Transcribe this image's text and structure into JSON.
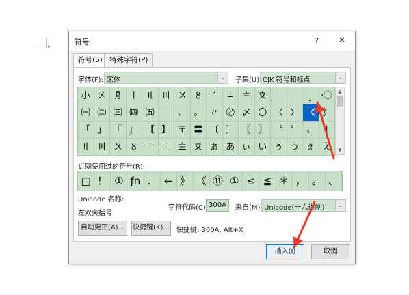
{
  "dialog": {
    "title": "符号",
    "help": "?",
    "close": "✕",
    "tabs": [
      {
        "label": "符号(S)"
      },
      {
        "label": "特殊字符(P)"
      }
    ],
    "font_label": "字体(F):",
    "font_value": "宋体",
    "subset_label": "子集(U):",
    "subset_value": "CJK 符号和标点",
    "grid_rows": [
      [
        "小",
        "㐅",
        "㐆",
        "〡",
        "〢",
        "〣",
        "〤",
        "〥",
        "〦",
        "〧",
        "〨",
        "〩",
        "〪",
        "〫",
        "〭",
        "〮"
      ],
      [
        "㈠",
        "㈡",
        "㈢",
        "㈣",
        "㈤",
        "",
        "、",
        "。",
        "〃",
        "〄",
        "〆",
        "〇",
        "〈",
        "〉",
        "《",
        "》"
      ],
      [
        "「",
        "」",
        "『",
        "』",
        "【",
        "】",
        "〒",
        "〓",
        "〔",
        "〕",
        "〖",
        "〗",
        "〝",
        "〞",
        "〟",
        "〡"
      ],
      [
        "〢",
        "〣",
        "〤",
        "〥",
        "〦",
        "〧",
        "〨",
        "〩",
        "ぁ",
        "あ",
        "ぃ",
        "い",
        "ぅ",
        "う",
        "ぇ",
        "え"
      ]
    ],
    "selected_cell": "《",
    "recent_label": "近期使用过的符号(R):",
    "recent_symbols": [
      "□",
      "！",
      "①",
      "ƒn",
      "．",
      "←",
      "》",
      "《",
      "⑪",
      "①",
      "≤",
      "≦",
      "＊",
      "，",
      "。",
      "、"
    ],
    "unicode_name_label": "Unicode 名称:",
    "unicode_name_value": "左双尖括号",
    "char_code_label": "字符代码(C):",
    "char_code_value": "300A",
    "from_label": "来自(M):",
    "from_value": "Unicode(十六进制)",
    "autocorrect_button": "自动更正(A)...",
    "shortcut_button": "快捷键(K)...",
    "shortcut_text": "快捷键: 300A, Alt+X",
    "insert_button": "插入(I)",
    "cancel_button": "取消"
  },
  "colors": {
    "grid_bg": "#c7e0c7",
    "selected_bg": "#0a64c8",
    "arrow": "#e8392b"
  }
}
